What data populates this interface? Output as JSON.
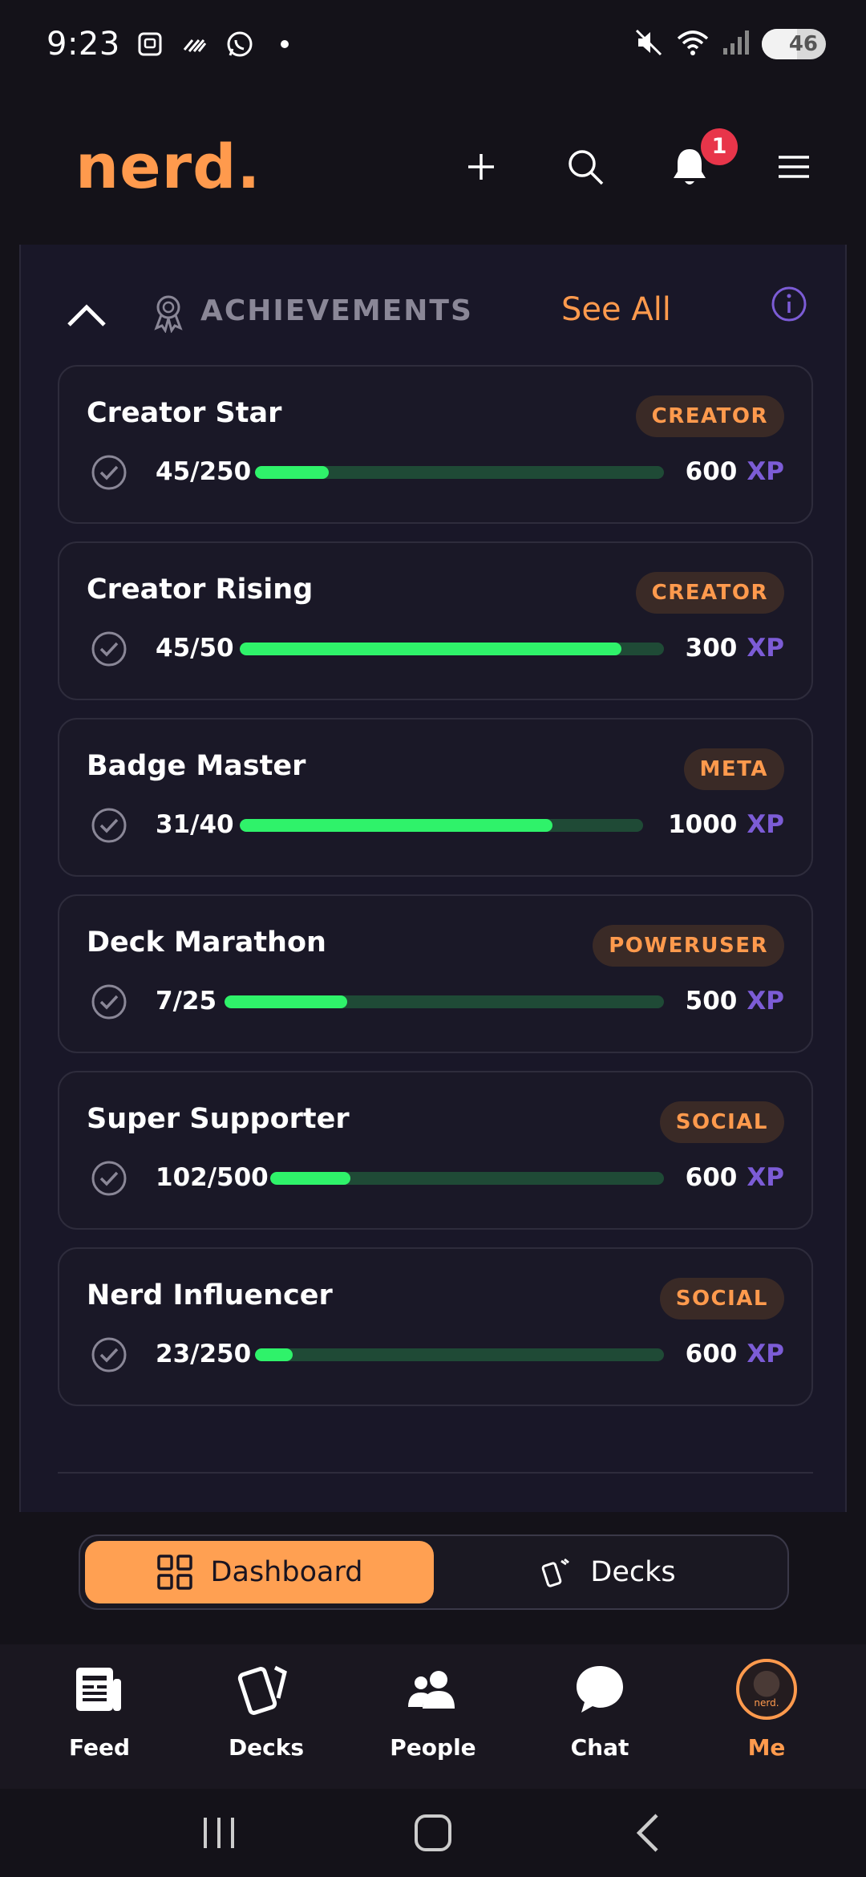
{
  "status_bar": {
    "time": "9:23",
    "battery": "46",
    "wifi_label": "6"
  },
  "header": {
    "logo": "nerd.",
    "notification_count": "1",
    "icons": [
      "plus-icon",
      "search-icon",
      "bell-icon",
      "menu-icon"
    ]
  },
  "section": {
    "title": "ACHIEVEMENTS",
    "see_all": "See All"
  },
  "achievements": [
    {
      "title": "Creator Star",
      "tag": "CREATOR",
      "progress": "45/250",
      "fraction": 0.18,
      "xp": "600",
      "xp_unit": "XP"
    },
    {
      "title": "Creator Rising",
      "tag": "CREATOR",
      "progress": "45/50",
      "fraction": 0.9,
      "xp": "300",
      "xp_unit": "XP"
    },
    {
      "title": "Badge Master",
      "tag": "META",
      "progress": "31/40",
      "fraction": 0.775,
      "xp": "1000",
      "xp_unit": "XP"
    },
    {
      "title": "Deck Marathon",
      "tag": "POWERUSER",
      "progress": "7/25",
      "fraction": 0.28,
      "xp": "500",
      "xp_unit": "XP"
    },
    {
      "title": "Super Supporter",
      "tag": "SOCIAL",
      "progress": "102/500",
      "fraction": 0.204,
      "xp": "600",
      "xp_unit": "XP"
    },
    {
      "title": "Nerd Influencer",
      "tag": "SOCIAL",
      "progress": "23/250",
      "fraction": 0.092,
      "xp": "600",
      "xp_unit": "XP"
    }
  ],
  "segment": {
    "dashboard": "Dashboard",
    "decks": "Decks"
  },
  "bottom_nav": {
    "feed": "Feed",
    "decks": "Decks",
    "people": "People",
    "chat": "Chat",
    "me": "Me",
    "avatar_text": "nerd."
  },
  "colors": {
    "accent": "#ff9a4d",
    "progress": "#2ff26a",
    "xp": "#7c5cd6",
    "background": "#141219"
  }
}
